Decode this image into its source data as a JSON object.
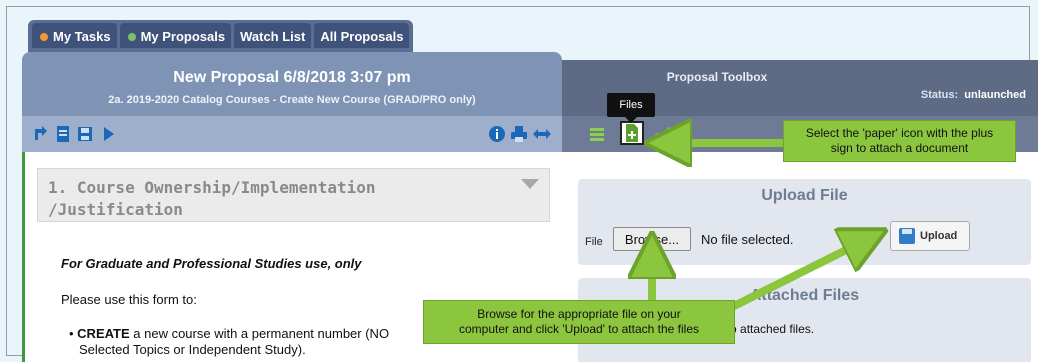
{
  "tabs": [
    {
      "label": "My Tasks",
      "dot_color": "#f29a2e"
    },
    {
      "label": "My Proposals",
      "dot_color": "#7cc16a"
    },
    {
      "label": "Watch List"
    },
    {
      "label": "All Proposals"
    }
  ],
  "proposal": {
    "title": "New Proposal 6/8/2018 3:07 pm",
    "subtitle": "2a. 2019-2020 Catalog Courses - Create New Course (GRAD/PRO only)"
  },
  "icons": {
    "left_toolbar": [
      "redo-arrow-icon",
      "document-icon",
      "save-icon",
      "play-icon",
      "info-icon",
      "print-icon",
      "expand-icon"
    ],
    "right_toolbar": [
      "list-icon",
      "files-add-icon",
      "check-icon"
    ]
  },
  "form": {
    "section_title_line1": "1. Course Ownership/Implementation",
    "section_title_line2": "/Justification",
    "intro_italic": "For Graduate and Professional Studies use, only",
    "use_text": "Please use this form to:",
    "bullet_bold": "CREATE",
    "bullet_rest": " a new course with a permanent number (NO",
    "bullet_line2": "Selected Topics or Independent Study)."
  },
  "toolbox": {
    "title": "Proposal Toolbox",
    "status_label": "Status:",
    "status_value": "unlaunched",
    "tooltip": "Files"
  },
  "upload": {
    "title": "Upload File",
    "file_label": "File",
    "browse_label": "Browse...",
    "no_file_text": "No file selected.",
    "upload_label": "Upload"
  },
  "attached": {
    "title": "Attached Files",
    "empty_text": "There are no attached files."
  },
  "callouts": {
    "top_line1": "Select the 'paper' icon with the plus",
    "top_line2": "sign to attach a document",
    "bottom_line1": "Browse for the appropriate file on your",
    "bottom_line2": "computer and click 'Upload' to attach the files"
  },
  "colors": {
    "accent_green": "#8cc63f",
    "left_header": "#7f93b5",
    "right_header": "#5d6b85"
  }
}
